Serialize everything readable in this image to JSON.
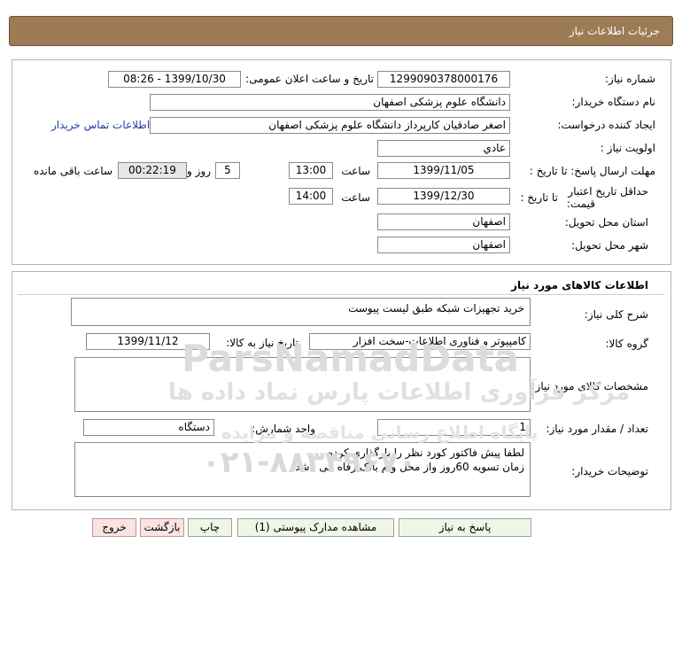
{
  "header": {
    "title": "جزئیات اطلاعات نیاز"
  },
  "info": {
    "need_number_label": "شماره نیاز:",
    "need_number": "1299090378000176",
    "announce_label": "تاریخ و ساعت اعلان عمومی:",
    "announce_value": "1399/10/30 - 08:26",
    "buyer_org_label": "نام دستگاه خریدار:",
    "buyer_org": "دانشگاه علوم پزشکی اصفهان",
    "creator_label": "ایجاد کننده درخواست:",
    "creator": "اصغر صادقیان کارپرداز دانشگاه علوم پزشکی اصفهان",
    "contact_link": "اطلاعات تماس خریدار",
    "priority_label": "اولویت نیاز :",
    "priority": "عادي",
    "reply_deadline_label": "مهلت ارسال پاسخ: تا تاریخ :",
    "reply_date": "1399/11/05",
    "time_label": "ساعت",
    "reply_time": "13:00",
    "days": "5",
    "days_label": "روز و",
    "remaining": "00:22:19",
    "remaining_label": "ساعت باقی مانده",
    "price_validity_label1": "حداقل تاریخ اعتبار",
    "price_validity_label2": "قیمت:",
    "to_date_label": "تا تاریخ :",
    "validity_date": "1399/12/30",
    "validity_time": "14:00",
    "province_label": "استان محل تحویل:",
    "province": "اصفهان",
    "city_label": "شهر محل تحویل:",
    "city": "اصفهان"
  },
  "goods": {
    "section_title": "اطلاعات کالاهای مورد نیاز",
    "description_label": "شرح کلی نیاز:",
    "description": "خرید تجهیزات شبکه طبق لیست پیوست",
    "group_label": "گروه کالا:",
    "group": "کامپیوتر و فناوری اطلاعات-سخت افزار",
    "need_date_label": "تاریخ نیاز به کالا:",
    "need_date": "1399/11/12",
    "specs_label": "مشخصات کالای مورد نیاز:",
    "specs": "",
    "qty_label": "تعداد / مقدار مورد نیاز:",
    "qty": "1",
    "unit_label": "واحد شمارش:",
    "unit": "دستگاه",
    "buyer_notes_label": "توضیحات خریدار:",
    "buyer_notes": "لطفا پیش فاکتور کورد نظر را بارگذاری کرده\nزمان تسویه 60روز واز محل وام بانک رفاه می باشد"
  },
  "buttons": {
    "reply": "پاسخ به نیاز",
    "attachments": "مشاهده مدارک پیوستی (1)",
    "print": "چاپ",
    "back": "بازگشت",
    "exit": "خروج"
  },
  "watermark": {
    "brand": "ParsNamadData",
    "line1": "مرکز فرآوری اطلاعات پارس نماد داده ها",
    "line2": "پایگاه اطلاع رسانی مناقصه و مزایده",
    "phone": "۰۲۱-۸۸۳۴۹۶۷۰"
  }
}
